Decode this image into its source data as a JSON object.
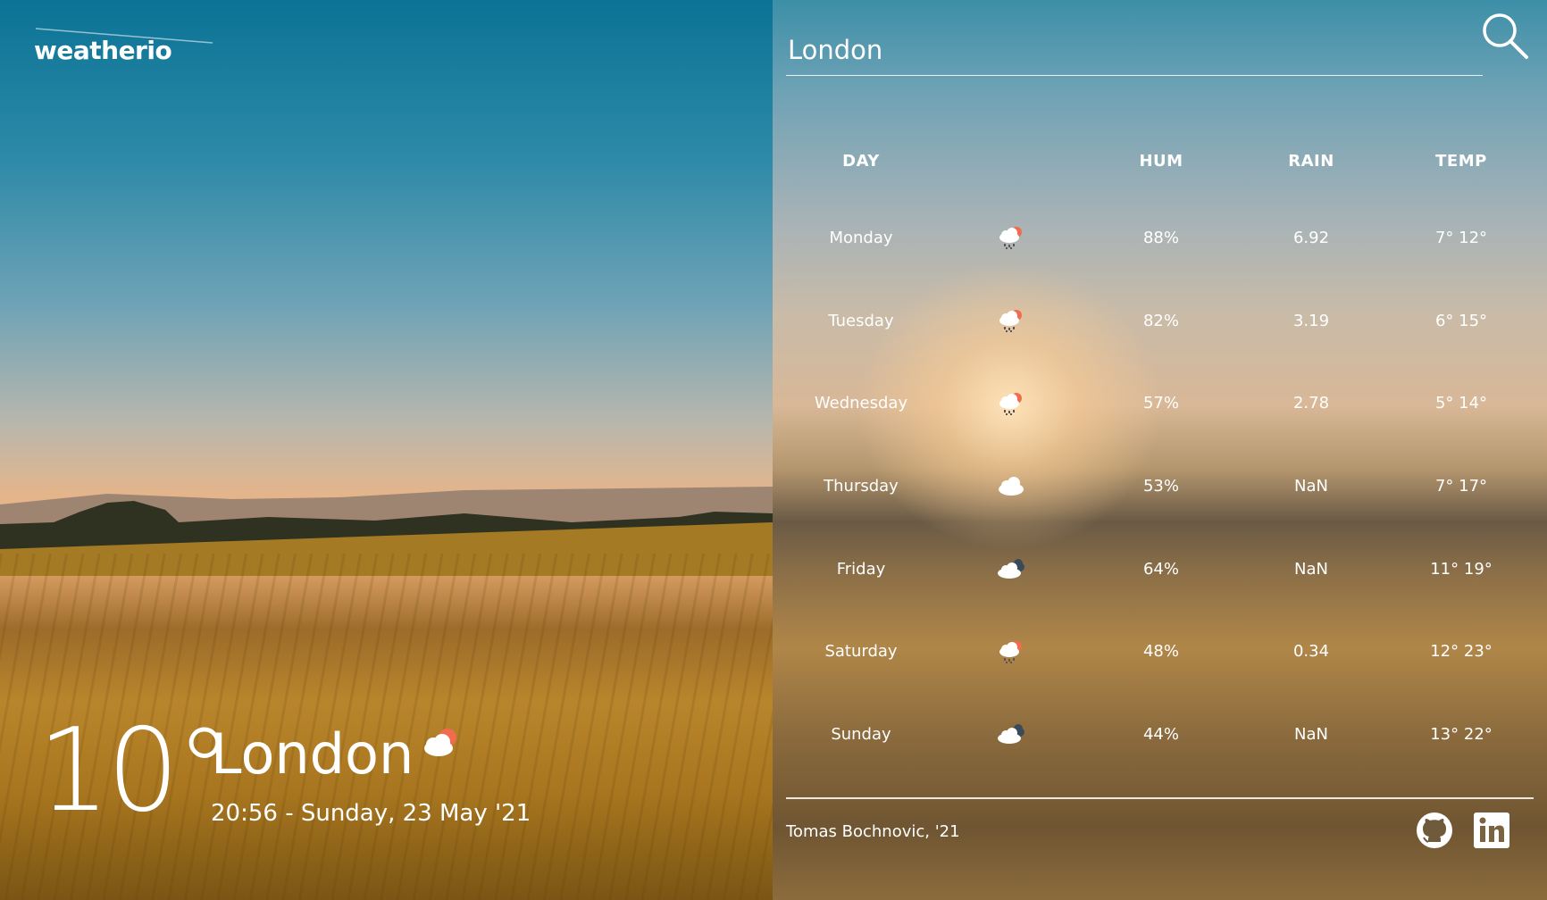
{
  "app": {
    "logo": "weatherio"
  },
  "current": {
    "temperature": "10°",
    "city": "London",
    "icon": "rain-cloud-sun-icon",
    "datetime": "20:56 - Sunday, 23 May '21"
  },
  "search": {
    "value": "London",
    "placeholder": ""
  },
  "table": {
    "headers": {
      "day": "DAY",
      "icon": "",
      "hum": "HUM",
      "rain": "RAIN",
      "temp": "TEMP"
    },
    "rows": [
      {
        "day": "Monday",
        "icon": "rain-sun-icon",
        "hum": "88%",
        "rain": "6.92",
        "temp": "7° 12°"
      },
      {
        "day": "Tuesday",
        "icon": "rain-sun-icon",
        "hum": "82%",
        "rain": "3.19",
        "temp": "6° 15°"
      },
      {
        "day": "Wednesday",
        "icon": "rain-sun-icon",
        "hum": "57%",
        "rain": "2.78",
        "temp": "5° 14°"
      },
      {
        "day": "Thursday",
        "icon": "cloud-icon",
        "hum": "53%",
        "rain": "NaN",
        "temp": "7° 17°"
      },
      {
        "day": "Friday",
        "icon": "dark-cloud-icon",
        "hum": "64%",
        "rain": "NaN",
        "temp": "11° 19°"
      },
      {
        "day": "Saturday",
        "icon": "rain-sun-icon",
        "hum": "48%",
        "rain": "0.34",
        "temp": "12° 23°"
      },
      {
        "day": "Sunday",
        "icon": "dark-cloud-icon",
        "hum": "44%",
        "rain": "NaN",
        "temp": "13° 22°"
      }
    ]
  },
  "footer": {
    "credit": "Tomas Bochnovic, '21",
    "github_icon": "github-icon",
    "linkedin_icon": "linkedin-icon"
  },
  "colors": {
    "sun": "#f26b4f",
    "cloud": "#ffffff",
    "dark_cloud": "#3b4a5a"
  }
}
